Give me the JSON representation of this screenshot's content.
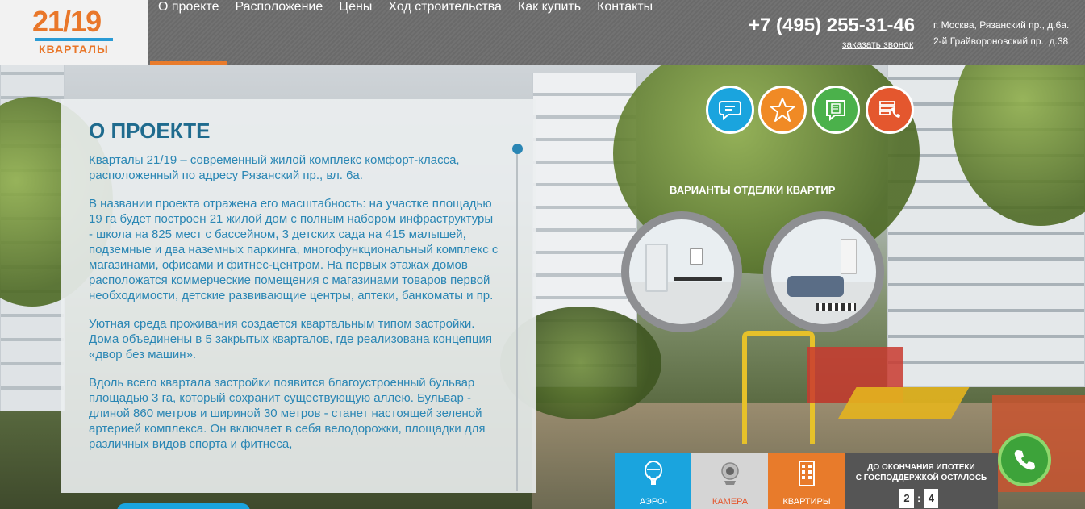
{
  "logo": {
    "number": "21/19",
    "subtitle": "КВАРТАЛЫ"
  },
  "nav": {
    "items": [
      {
        "label": "О проекте",
        "active": true
      },
      {
        "label": "Расположение"
      },
      {
        "label": "Цены"
      },
      {
        "label": "Ход строительства"
      },
      {
        "label": "Как купить"
      },
      {
        "label": "Контакты"
      }
    ]
  },
  "contact": {
    "phone": "+7 (495) 255-31-46",
    "callback": "заказать звонок",
    "address_line1": "г. Москва, Рязанский пр., д.6а.",
    "address_line2": "2-й Грайвороновский пр., д.38"
  },
  "about": {
    "title": "О ПРОЕКТЕ",
    "paragraphs": [
      "Кварталы 21/19 – современный жилой комплекс комфорт-класса, расположенный по адресу Рязанский пр., вл. 6а.",
      "В названии проекта отражена его масштабность: на участке площадью 19 га будет построен 21 жилой дом с полным набором инфраструктуры - школа на 825 мест с бассейном, 3 детских сада на 415 малышей, подземные и два наземных паркинга, многофункциональный комплекс с магазинами, офисами и фитнес-центром. На первых этажах домов расположатся коммерческие помещения с магазинами товаров первой необходимости, детские развивающие центры, аптеки, банкоматы и пр.",
      "Уютная среда проживания создается квартальным типом застройки. Дома объединены в 5 закрытых кварталов, где реализована концепция «двор без машин».",
      "Вдоль всего квартала застройки появится благоустроенный бульвар площадью 3 га, который сохранит существующую аллею. Бульвар - длиной 860 метров и шириной 30 метров - станет настоящей зеленой артерией комплекса. Он включает в себя велодорожки, площадки для различных видов спорта и фитнеса,"
    ]
  },
  "finishes": {
    "title": "ВАРИАНТЫ ОТДЕЛКИ КВАРТИР"
  },
  "tiles": {
    "aero": "АЭРО-",
    "camera": "КАМЕРА",
    "flats": "КВАРТИРЫ"
  },
  "countdown": {
    "line1": "ДО ОКОНЧАНИЯ ИПОТЕКИ",
    "line2": "С ГОСПОДДЕРЖКОЙ ОСТАЛОСЬ",
    "digit1": "2",
    "separator": ":",
    "digit2": "4"
  },
  "colors": {
    "accent_orange": "#e87b2b",
    "accent_blue": "#1aa4de",
    "accent_green": "#4bb14b",
    "accent_red": "#e4572e",
    "title_blue": "#1f6b8e"
  },
  "icons": [
    "chat-icon",
    "star-icon",
    "document-chat-icon",
    "phone-list-icon",
    "balloon-icon",
    "webcam-icon",
    "building-icon",
    "phone-icon"
  ]
}
